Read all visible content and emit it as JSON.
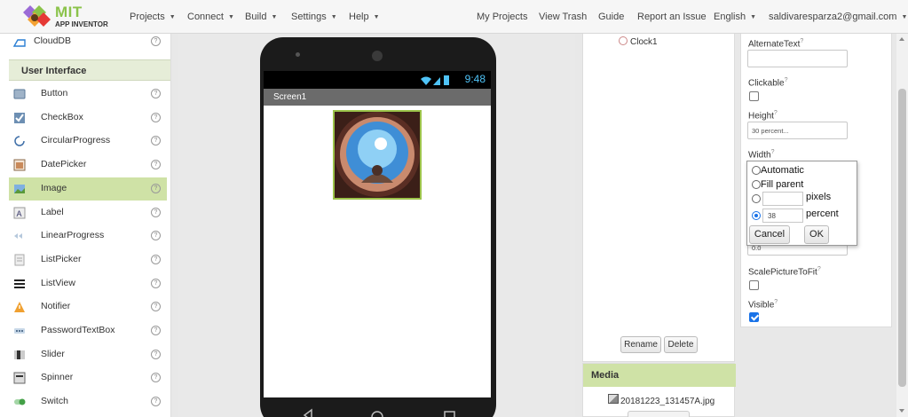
{
  "header": {
    "logo_text": "MIT",
    "logo_sub": "APP INVENTOR",
    "menus": [
      "Projects",
      "Connect",
      "Build",
      "Settings",
      "Help"
    ],
    "right_links": [
      "My Projects",
      "View Trash",
      "Guide",
      "Report an Issue"
    ],
    "language": "English",
    "account": "saldivaresparza2@gmail.com"
  },
  "palette": {
    "top_item": "CloudDB",
    "section": "User Interface",
    "items": [
      {
        "label": "Button",
        "icon": "button-icon"
      },
      {
        "label": "CheckBox",
        "icon": "checkbox-icon"
      },
      {
        "label": "CircularProgress",
        "icon": "circular-progress-icon"
      },
      {
        "label": "DatePicker",
        "icon": "datepicker-icon"
      },
      {
        "label": "Image",
        "icon": "image-icon",
        "selected": true
      },
      {
        "label": "Label",
        "icon": "label-icon"
      },
      {
        "label": "LinearProgress",
        "icon": "linear-progress-icon"
      },
      {
        "label": "ListPicker",
        "icon": "listpicker-icon"
      },
      {
        "label": "ListView",
        "icon": "listview-icon"
      },
      {
        "label": "Notifier",
        "icon": "notifier-icon"
      },
      {
        "label": "PasswordTextBox",
        "icon": "password-icon"
      },
      {
        "label": "Slider",
        "icon": "slider-icon"
      },
      {
        "label": "Spinner",
        "icon": "spinner-icon"
      },
      {
        "label": "Switch",
        "icon": "switch-icon"
      }
    ],
    "help_glyph": "?"
  },
  "viewer": {
    "status_time": "9:48",
    "screen_title": "Screen1"
  },
  "components": {
    "items": [
      "Clock1"
    ],
    "rename_label": "Rename",
    "delete_label": "Delete"
  },
  "media": {
    "title": "Media",
    "file": "20181223_131457A.jpg"
  },
  "properties": {
    "alternate_text_label": "AlternateText",
    "clickable_label": "Clickable",
    "clickable_checked": false,
    "height_label": "Height",
    "height_value": "30 percent...",
    "width_label": "Width",
    "hidden_value": "0.0",
    "scale_label": "ScalePictureToFit",
    "scale_checked": false,
    "visible_label": "Visible",
    "visible_checked": true
  },
  "width_popup": {
    "options": [
      "Automatic",
      "Fill parent",
      "pixels",
      "percent"
    ],
    "selected": "percent",
    "pixels_value": "",
    "percent_value": "38",
    "cancel_label": "Cancel",
    "ok_label": "OK"
  },
  "colors": {
    "accent_green": "#8bc34a",
    "selected_row": "#cfe2a6",
    "checkbox_blue": "#1a73e8"
  }
}
